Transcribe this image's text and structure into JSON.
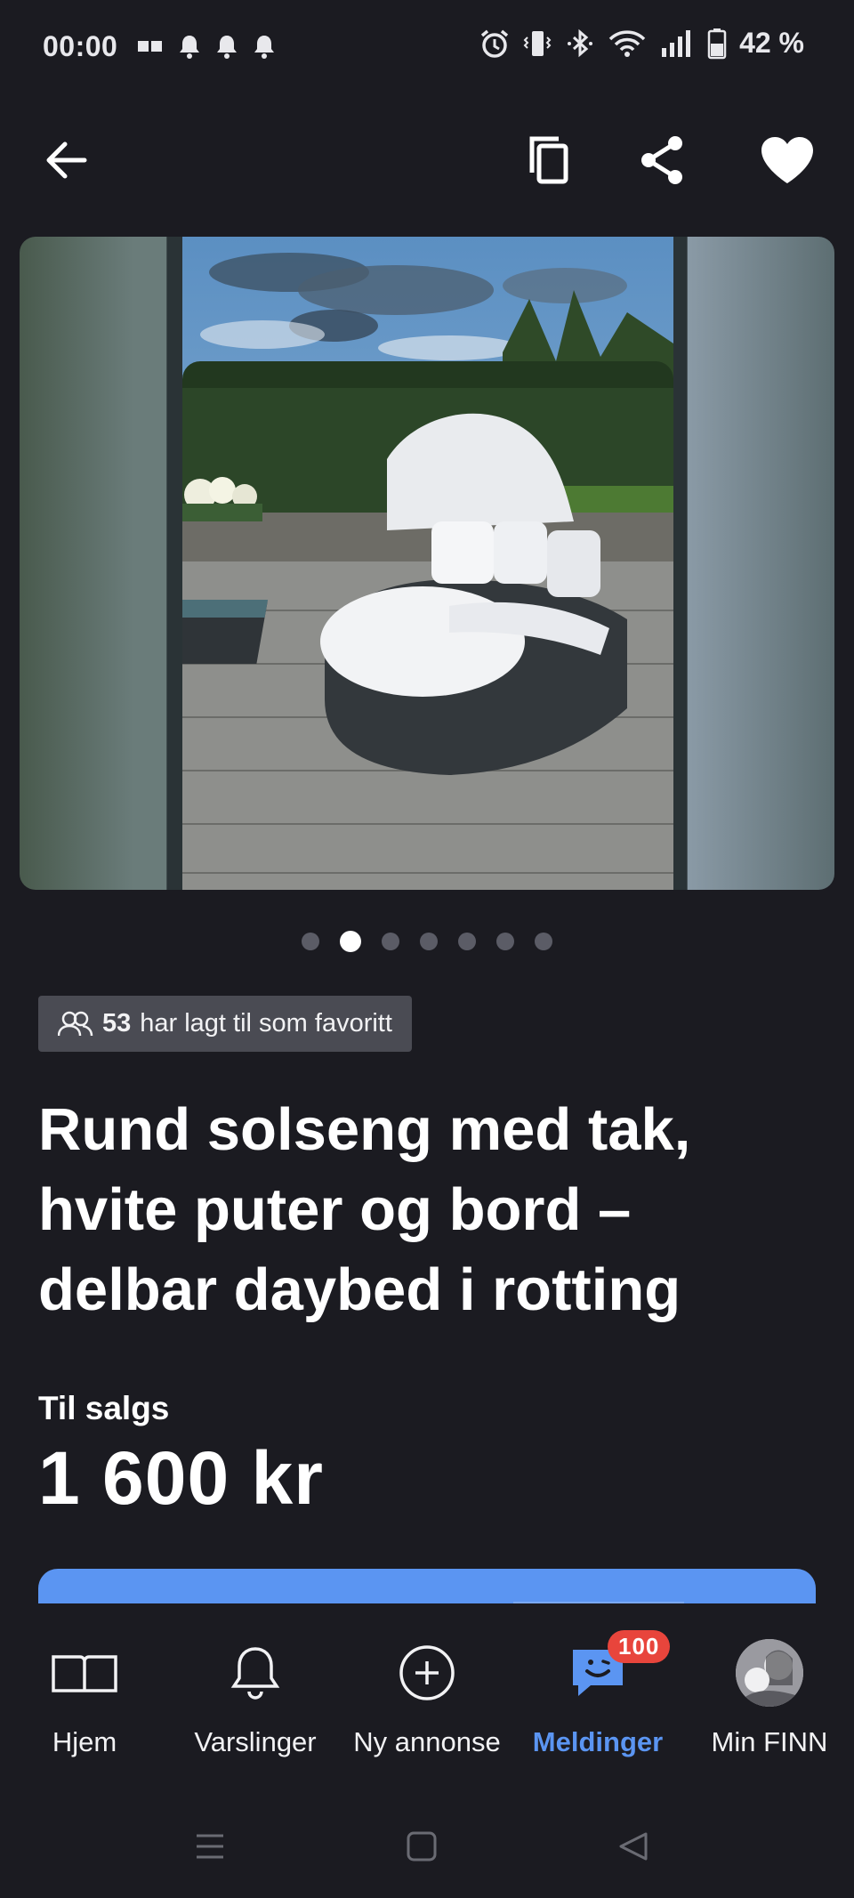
{
  "status_bar": {
    "time": "00:00",
    "battery_percent": "42 %",
    "left_icons": [
      "sim-icon",
      "notification-bell-icon",
      "notification-bell-icon",
      "notification-bell-icon"
    ],
    "right_icons": [
      "alarm-icon",
      "vibrate-icon",
      "bluetooth-icon",
      "wifi-icon",
      "signal-icon",
      "battery-icon"
    ]
  },
  "top_bar": {
    "icons": [
      "back-arrow-icon",
      "copy-icon",
      "share-icon",
      "favorite-heart-icon"
    ]
  },
  "gallery": {
    "image_count": 7,
    "active_index": 1
  },
  "listing": {
    "favorites_count": "53",
    "favorites_text": "har lagt til som favoritt",
    "title": "Rund solseng med tak, hvite puter og bord – delbar daybed i rotting",
    "sale_label": "Til salgs",
    "price": "1 600 kr"
  },
  "bottom_nav": {
    "items": [
      {
        "label": "Hjem",
        "icon": "book-icon"
      },
      {
        "label": "Varslinger",
        "icon": "bell-icon"
      },
      {
        "label": "Ny annonse",
        "icon": "plus-circle-icon"
      },
      {
        "label": "Meldinger",
        "icon": "chat-icon",
        "badge": "100",
        "active": true
      },
      {
        "label": "Min FINN",
        "icon": "avatar"
      }
    ]
  },
  "colors": {
    "background": "#1b1b21",
    "accent": "#5b95f2",
    "badge": "#e8453c"
  }
}
